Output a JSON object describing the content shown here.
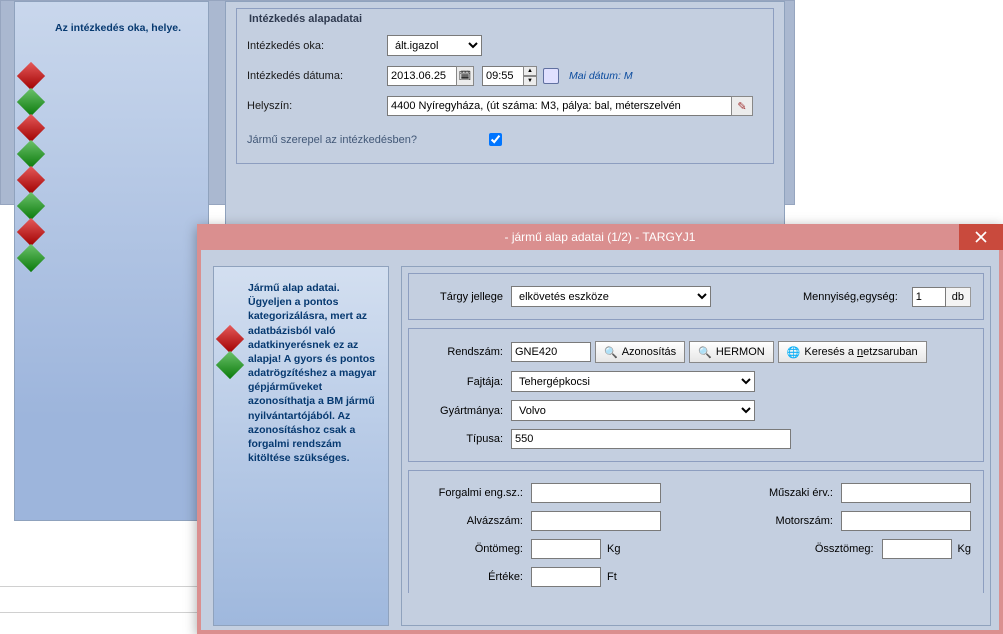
{
  "back": {
    "sidebar_help": "Az intézkedés oka, helye.",
    "box_title": "Intézkedés alapadatai",
    "reason_label": "Intézkedés oka:",
    "reason_value": "ált.igazol",
    "date_label": "Intézkedés dátuma:",
    "date_value": "2013.06.25",
    "time_value": "09:55",
    "today_hint": "Mai dátum: M",
    "loc_label": "Helyszín:",
    "loc_value": "4400 Nyíregyháza, (út száma: M3, pálya: bal, méterszelvén",
    "vehicle_in_case_label": "Jármű szerepel az intézkedésben?",
    "vehicle_in_case_checked": true
  },
  "modal": {
    "title": "- jármű alap adatai (1/2) - TARGYJ1",
    "sidebar_help": "Jármű alap adatai. Ügyeljen a pontos kategorizálásra, mert az adatbázisból való adatkinyerésnek ez az alapja! A gyors és pontos adatrögzítéshez a magyar gépjárműveket azonosíthatja a BM jármű nyilvántartójából. Az azonosításhoz csak a forgalmi rendszám kitöltése szükséges.",
    "targy_label": "Tárgy jellege",
    "targy_value": "elkövetés eszköze",
    "qty_label": "Mennyiség,egység:",
    "qty_value": "1",
    "qty_unit": "db",
    "plate_label": "Rendszám:",
    "plate_value": "GNE420",
    "btn_azon": "Azonosítás",
    "btn_hermon": "HERMON",
    "btn_netz": "Keresés a netzsaruban",
    "kind_label": "Fajtája:",
    "kind_value": "Tehergépkocsi",
    "make_label": "Gyártmánya:",
    "make_value": "Volvo",
    "type_label": "Típusa:",
    "type_value": "550",
    "reg_label": "Forgalmi eng.sz.:",
    "reg_value": "",
    "tech_label": "Műszaki érv.:",
    "tech_value": "",
    "chassis_label": "Alvázszám:",
    "chassis_value": "",
    "engine_label": "Motorszám:",
    "engine_value": "",
    "curb_label": "Öntömeg:",
    "curb_value": "",
    "gross_label": "Össztömeg:",
    "gross_value": "",
    "kg": "Kg",
    "value_label": "Értéke:",
    "value_value": "",
    "ft": "Ft"
  }
}
